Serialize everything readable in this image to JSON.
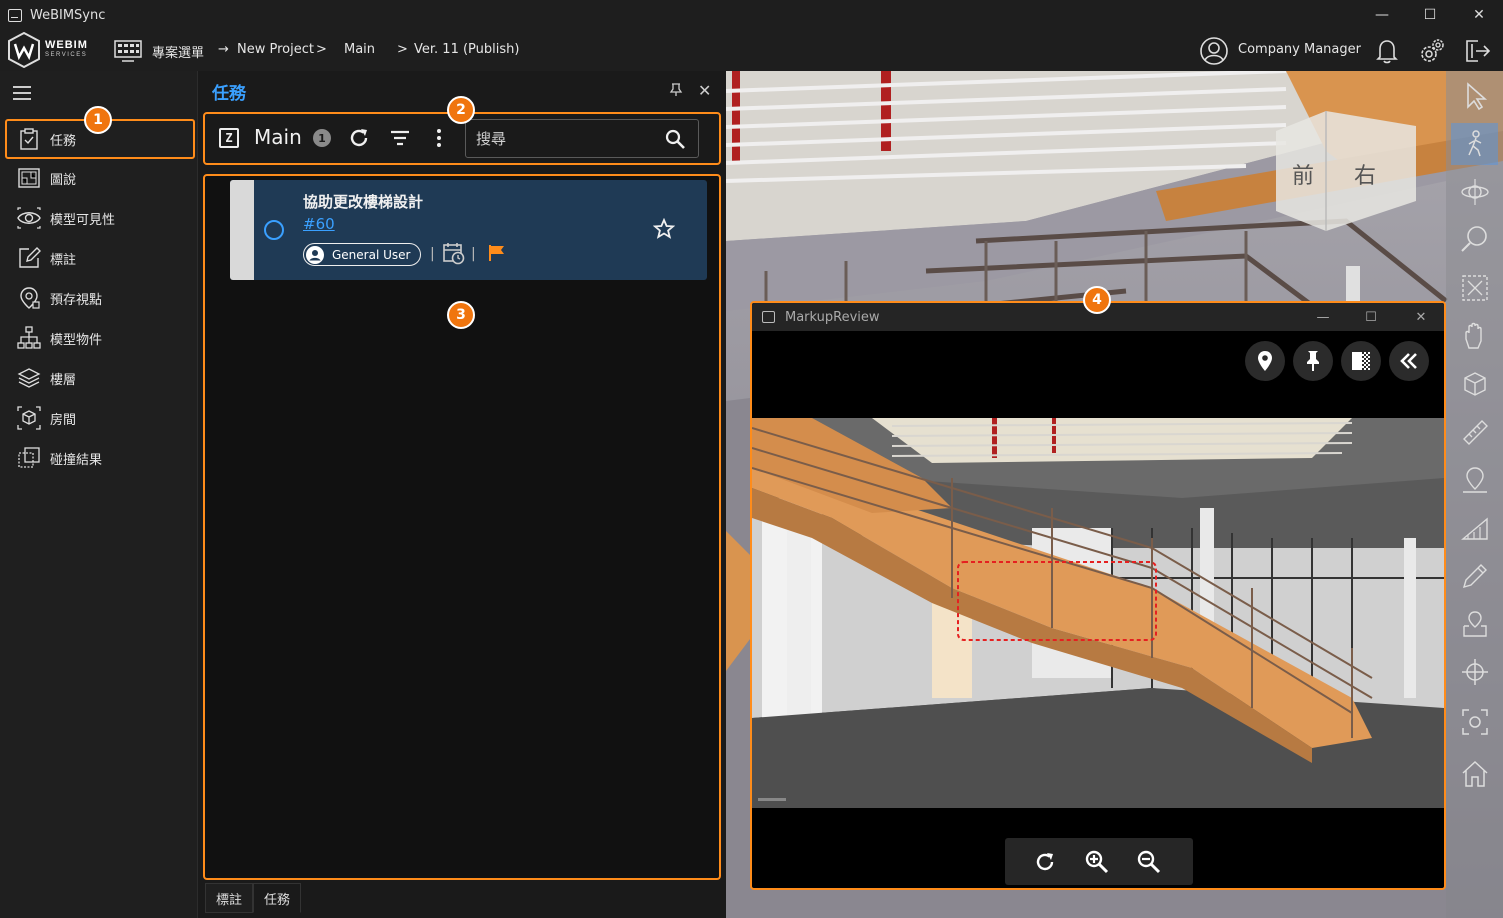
{
  "window": {
    "title": "WeBIMSync",
    "minimize": "—",
    "maximize": "☐",
    "close": "✕"
  },
  "logo": {
    "line1": "WEBIM",
    "line2": "SERVICES"
  },
  "breadcrumb": {
    "project_menu": "專案選單",
    "arrow": "→",
    "project": "New Project",
    "sep1": ">",
    "model": "Main",
    "sep2": ">",
    "version": "Ver. 11 (Publish)"
  },
  "user": {
    "name": "Company Manager"
  },
  "sidebar": {
    "items": [
      {
        "label": "任務",
        "icon": "clipboard-check-icon"
      },
      {
        "label": "圖說",
        "icon": "drawing-icon"
      },
      {
        "label": "模型可見性",
        "icon": "eye-icon"
      },
      {
        "label": "標註",
        "icon": "edit-icon"
      },
      {
        "label": "預存視點",
        "icon": "viewpoint-icon"
      },
      {
        "label": "模型物件",
        "icon": "hierarchy-icon"
      },
      {
        "label": "樓層",
        "icon": "layers-icon"
      },
      {
        "label": "房間",
        "icon": "room-cube-icon"
      },
      {
        "label": "碰撞結果",
        "icon": "clash-icon"
      }
    ]
  },
  "task_panel": {
    "title": "任務",
    "close": "✕",
    "model_letter": "Z",
    "model_name": "Main",
    "count": "1",
    "search_placeholder": "搜尋",
    "tasks": [
      {
        "title": "協助更改樓梯設計",
        "id": "#60",
        "assignee": "General User",
        "sep": "|",
        "flag_color": "#ff8c1a"
      }
    ],
    "bottom_tabs": [
      "標註",
      "任務"
    ]
  },
  "markup_review": {
    "title": "MarkupReview",
    "minimize": "—",
    "maximize": "☐",
    "close": "✕"
  },
  "badges": [
    "1",
    "2",
    "3",
    "4"
  ],
  "colors": {
    "accent_orange": "#ff8c1a",
    "badge_orange": "#f0750e",
    "link_blue": "#3aa0ff",
    "card_blue": "#1f3a55"
  },
  "viewcube": {
    "front": "前",
    "right": "右"
  }
}
